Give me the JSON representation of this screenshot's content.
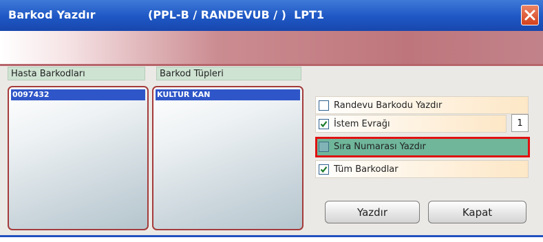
{
  "window": {
    "title": "Barkod Yazdır",
    "subtitle": "(PPL-B / RANDEVUB / )  LPT1"
  },
  "columns": {
    "hasta": {
      "header": "Hasta Barkodları",
      "items": [
        "0097432"
      ]
    },
    "tupler": {
      "header": "Barkod Tüpleri",
      "items": [
        "KULTUR KAN"
      ]
    }
  },
  "options": [
    {
      "label": "Randevu Barkodu Yazdır",
      "checked": false
    },
    {
      "label": "İstem Evrağı",
      "checked": true
    },
    {
      "label": "Sıra Numarası Yazdır",
      "checked": false
    },
    {
      "label": "Tüm Barkodlar",
      "checked": true
    }
  ],
  "istem_count": "1",
  "buttons": {
    "yazdir": "Yazdır",
    "kapat": "Kapat"
  },
  "colors": {
    "title_bar": "#1e57c4",
    "highlight_border": "#e01010",
    "list_selection": "#2f56c8"
  },
  "icons": {
    "close": "close-icon",
    "check": "checkmark-icon"
  }
}
